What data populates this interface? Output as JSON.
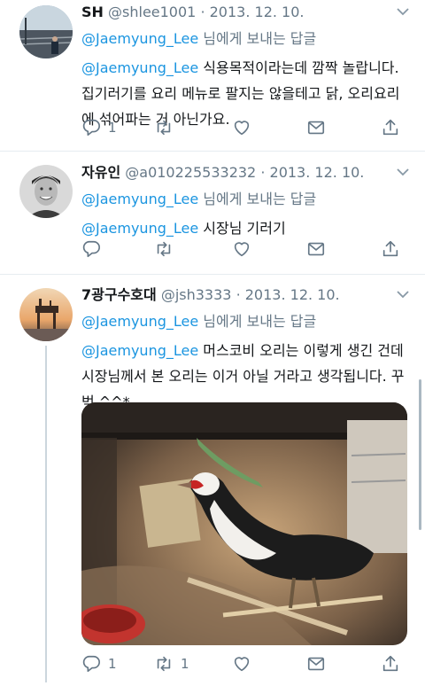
{
  "tweets": [
    {
      "name": "SH",
      "handle": "@shlee1001",
      "sep": "·",
      "date": "2013. 12. 10.",
      "reply_to": "@Jaemyung_Lee",
      "reply_suffix": " 님에게 보내는 답글",
      "mention": "@Jaemyung_Lee",
      "text": " 식용목적이라는데 깜짝 놀랍니다. 집기러기를 요리 메뉴로 팔지는 않을테고 닭, 오리요리에 섞어파는 거 아닌가요.",
      "reply_count": "1",
      "retweet_count": "",
      "like_count": ""
    },
    {
      "name": "자유인",
      "handle": "@a010225533232",
      "sep": "·",
      "date": "2013. 12. 10.",
      "reply_to": "@Jaemyung_Lee",
      "reply_suffix": " 님에게 보내는 답글",
      "mention": "@Jaemyung_Lee",
      "text": " 시장님 기러기",
      "reply_count": "",
      "retweet_count": "",
      "like_count": ""
    },
    {
      "name": "7광구수호대",
      "handle": "@jsh3333",
      "sep": "·",
      "date": "2013. 12. 10.",
      "reply_to": "@Jaemyung_Lee",
      "reply_suffix": " 님에게 보내는 답글",
      "mention": "@Jaemyung_Lee",
      "text": " 머스코비 오리는 이렇게 생긴 건데 시장님께서 본 오리는 이거 아닐 거라고 생각됩니다. 꾸벅 ^^*",
      "reply_count": "1",
      "retweet_count": "1",
      "like_count": ""
    }
  ],
  "icons": {
    "reply": "reply-icon",
    "retweet": "retweet-icon",
    "like": "heart-icon",
    "dm": "mail-icon",
    "share": "share-icon",
    "more": "chevron-down-icon"
  },
  "colors": {
    "link": "#1b95e0",
    "secondary_text": "#657786",
    "divider": "#e6ecf0",
    "thread_line": "#ccd6dd"
  }
}
